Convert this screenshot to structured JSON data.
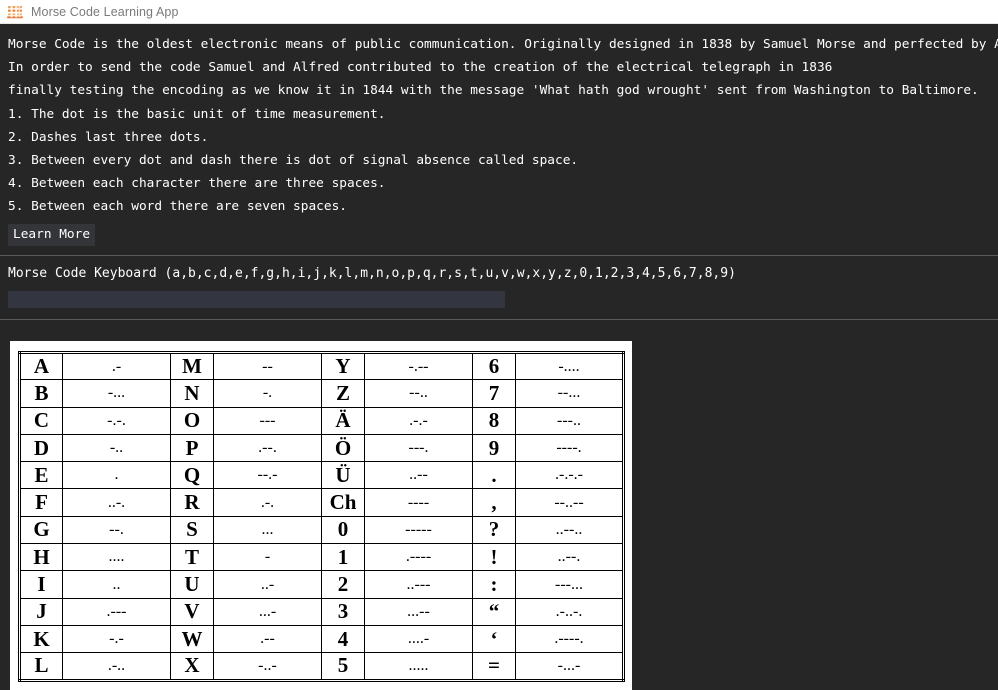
{
  "titlebar": {
    "icon": "abacus-icon",
    "title": "Morse Code Learning App"
  },
  "intro": {
    "paragraphs": [
      "Morse Code is the oldest electronic means of public communication. Originally designed in 1838 by Samuel Morse and perfected by Alfred Vail.",
      "In order to send the code Samuel and Alfred contributed to the creation of the electrical telegraph in 1836",
      "finally testing the encoding as we know it in 1844 with the message 'What hath god wrought' sent from Washington to Baltimore."
    ],
    "rules": [
      "1. The dot is the basic unit of time measurement.",
      "2. Dashes last three dots.",
      "3. Between every dot and dash there is dot of signal absence called space.",
      "4. Between each character there are three spaces.",
      "5. Between each word there are seven spaces."
    ],
    "learn_more_label": "Learn More"
  },
  "keyboard": {
    "label_prefix": "Morse Code Keyboard ",
    "charset": "(a,b,c,d,e,f,g,h,i,j,k,l,m,n,o,p,q,r,s,t,u,v,w,x,y,z,0,1,2,3,4,5,6,7,8,9)",
    "input_value": "",
    "input_placeholder": ""
  },
  "morse_table": {
    "columns": 4,
    "rows": [
      [
        {
          "ch": "A",
          "code": ".-"
        },
        {
          "ch": "M",
          "code": "--"
        },
        {
          "ch": "Y",
          "code": "-.--"
        },
        {
          "ch": "6",
          "code": "-...."
        }
      ],
      [
        {
          "ch": "B",
          "code": "-..."
        },
        {
          "ch": "N",
          "code": "-."
        },
        {
          "ch": "Z",
          "code": "--.."
        },
        {
          "ch": "7",
          "code": "--..."
        }
      ],
      [
        {
          "ch": "C",
          "code": "-.-."
        },
        {
          "ch": "O",
          "code": "---"
        },
        {
          "ch": "Ä",
          "code": ".-.-"
        },
        {
          "ch": "8",
          "code": "---.."
        }
      ],
      [
        {
          "ch": "D",
          "code": "-.."
        },
        {
          "ch": "P",
          "code": ".--."
        },
        {
          "ch": "Ö",
          "code": "---."
        },
        {
          "ch": "9",
          "code": "----."
        }
      ],
      [
        {
          "ch": "E",
          "code": "."
        },
        {
          "ch": "Q",
          "code": "--.-"
        },
        {
          "ch": "Ü",
          "code": "..--"
        },
        {
          "ch": ".",
          "code": ".-.-.-"
        }
      ],
      [
        {
          "ch": "F",
          "code": "..-."
        },
        {
          "ch": "R",
          "code": ".-."
        },
        {
          "ch": "Ch",
          "code": "----"
        },
        {
          "ch": ",",
          "code": "--..--"
        }
      ],
      [
        {
          "ch": "G",
          "code": "--."
        },
        {
          "ch": "S",
          "code": "..."
        },
        {
          "ch": "0",
          "code": "-----"
        },
        {
          "ch": "?",
          "code": "..--.."
        }
      ],
      [
        {
          "ch": "H",
          "code": "...."
        },
        {
          "ch": "T",
          "code": "-"
        },
        {
          "ch": "1",
          "code": ".----"
        },
        {
          "ch": "!",
          "code": "..--."
        }
      ],
      [
        {
          "ch": "I",
          "code": ".."
        },
        {
          "ch": "U",
          "code": "..-"
        },
        {
          "ch": "2",
          "code": "..---"
        },
        {
          "ch": ":",
          "code": "---..."
        }
      ],
      [
        {
          "ch": "J",
          "code": ".---"
        },
        {
          "ch": "V",
          "code": "...-"
        },
        {
          "ch": "3",
          "code": "...--"
        },
        {
          "ch": "“",
          "code": ".-..-."
        }
      ],
      [
        {
          "ch": "K",
          "code": "-.-"
        },
        {
          "ch": "W",
          "code": ".--"
        },
        {
          "ch": "4",
          "code": "....-"
        },
        {
          "ch": "‘",
          "code": ".----."
        }
      ],
      [
        {
          "ch": "L",
          "code": ".-.."
        },
        {
          "ch": "X",
          "code": "-..-"
        },
        {
          "ch": "5",
          "code": "....."
        },
        {
          "ch": "=",
          "code": "-...-"
        }
      ]
    ]
  },
  "colors": {
    "background": "#262626",
    "text": "#ffffff",
    "titlebar_bg": "#ffffff",
    "titlebar_text": "#7a7a7a",
    "input_bg": "#333540",
    "button_bg": "#333538",
    "separator": "#5a5a5a",
    "card_bg": "#ffffff",
    "table_border": "#000000",
    "icon_accent": "#ef8033"
  }
}
